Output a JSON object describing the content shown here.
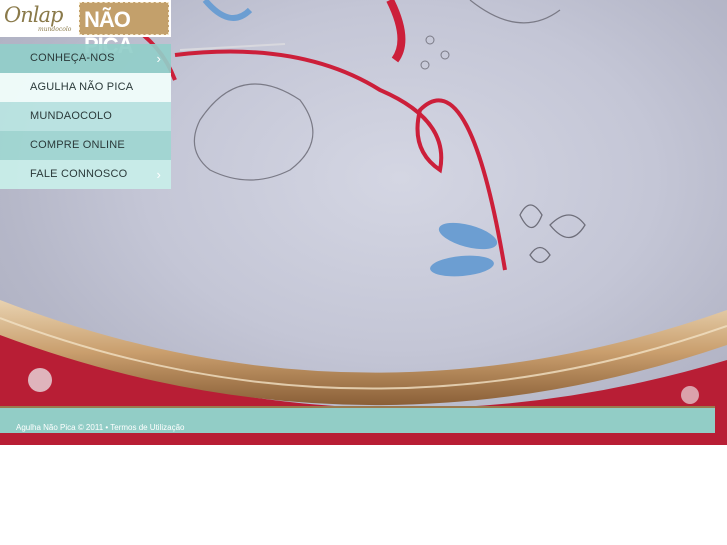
{
  "logo": {
    "script_text": "Onlap",
    "sub_text": "mundocolo",
    "badge_text": "NÃO PICA"
  },
  "menu": {
    "items": [
      {
        "label": "CONHEÇA-NOS"
      },
      {
        "label": "AGULHA NÃO PICA"
      },
      {
        "label": "MUNDAOCOLO"
      },
      {
        "label": "COMPRE ONLINE"
      },
      {
        "label": "FALE CONNOSCO"
      }
    ],
    "chevron": "›"
  },
  "footer": {
    "text": "Agulha Não Pica © 2011 • Termos de Utilização"
  },
  "colors": {
    "accent_teal": "#92cdc6",
    "thread_red": "#cc1f3a",
    "thread_blue": "#6c9ed2",
    "hoop_wood": "#c99e6d"
  }
}
